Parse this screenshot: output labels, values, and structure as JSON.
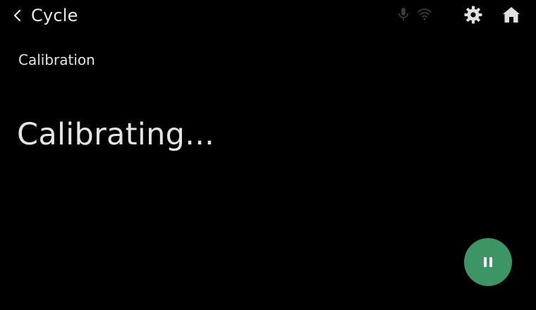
{
  "header": {
    "back_icon": "chevron-left-icon",
    "title": "Cycle",
    "status_icons": [
      "microphone-icon",
      "wifi-icon"
    ],
    "settings_icon": "gear-icon",
    "home_icon": "home-icon"
  },
  "main": {
    "section_label": "Calibration",
    "status_message": "Calibrating..."
  },
  "controls": {
    "pause_icon": "pause-icon",
    "pause_button_color": "#3d9464"
  },
  "colors": {
    "background": "#000000",
    "text": "#e6e6e6",
    "status_icon_dim": "#3a3a3a",
    "accent": "#3d9464"
  }
}
